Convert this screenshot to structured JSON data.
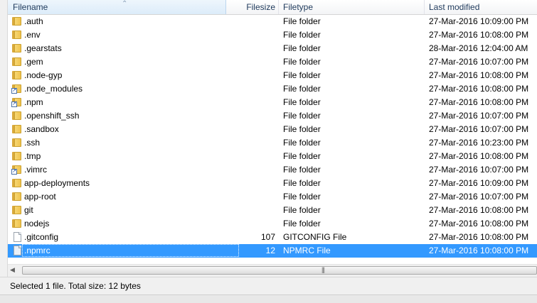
{
  "columns": {
    "filename": "Filename",
    "filesize": "Filesize",
    "filetype": "Filetype",
    "last_modified": "Last modified"
  },
  "files": [
    {
      "name": ".auth",
      "size": "",
      "type": "File folder",
      "modified": "27-Mar-2016 10:09:00 PM",
      "icon": "folder-icon"
    },
    {
      "name": ".env",
      "size": "",
      "type": "File folder",
      "modified": "27-Mar-2016 10:08:00 PM",
      "icon": "folder-icon"
    },
    {
      "name": ".gearstats",
      "size": "",
      "type": "File folder",
      "modified": "28-Mar-2016 12:04:00 AM",
      "icon": "folder-icon"
    },
    {
      "name": ".gem",
      "size": "",
      "type": "File folder",
      "modified": "27-Mar-2016 10:07:00 PM",
      "icon": "folder-icon"
    },
    {
      "name": ".node-gyp",
      "size": "",
      "type": "File folder",
      "modified": "27-Mar-2016 10:08:00 PM",
      "icon": "folder-icon"
    },
    {
      "name": ".node_modules",
      "size": "",
      "type": "File folder",
      "modified": "27-Mar-2016 10:08:00 PM",
      "icon": "folder-link-icon"
    },
    {
      "name": ".npm",
      "size": "",
      "type": "File folder",
      "modified": "27-Mar-2016 10:08:00 PM",
      "icon": "folder-link-icon"
    },
    {
      "name": ".openshift_ssh",
      "size": "",
      "type": "File folder",
      "modified": "27-Mar-2016 10:07:00 PM",
      "icon": "folder-icon"
    },
    {
      "name": ".sandbox",
      "size": "",
      "type": "File folder",
      "modified": "27-Mar-2016 10:07:00 PM",
      "icon": "folder-icon"
    },
    {
      "name": ".ssh",
      "size": "",
      "type": "File folder",
      "modified": "27-Mar-2016 10:23:00 PM",
      "icon": "folder-icon"
    },
    {
      "name": ".tmp",
      "size": "",
      "type": "File folder",
      "modified": "27-Mar-2016 10:08:00 PM",
      "icon": "folder-icon"
    },
    {
      "name": ".vimrc",
      "size": "",
      "type": "File folder",
      "modified": "27-Mar-2016 10:07:00 PM",
      "icon": "folder-link-icon"
    },
    {
      "name": "app-deployments",
      "size": "",
      "type": "File folder",
      "modified": "27-Mar-2016 10:09:00 PM",
      "icon": "folder-icon"
    },
    {
      "name": "app-root",
      "size": "",
      "type": "File folder",
      "modified": "27-Mar-2016 10:07:00 PM",
      "icon": "folder-icon"
    },
    {
      "name": "git",
      "size": "",
      "type": "File folder",
      "modified": "27-Mar-2016 10:08:00 PM",
      "icon": "folder-icon"
    },
    {
      "name": "nodejs",
      "size": "",
      "type": "File folder",
      "modified": "27-Mar-2016 10:08:00 PM",
      "icon": "folder-icon"
    },
    {
      "name": ".gitconfig",
      "size": "107",
      "type": "GITCONFIG File",
      "modified": "27-Mar-2016 10:08:00 PM",
      "icon": "file-icon"
    },
    {
      "name": ".npmrc",
      "size": "12",
      "type": "NPMRC File",
      "modified": "27-Mar-2016 10:08:00 PM",
      "icon": "file-icon",
      "selected": true
    }
  ],
  "status": {
    "text": "Selected 1 file. Total size: 12 bytes"
  },
  "colors": {
    "selection": "#3399ff",
    "header_text": "#1e395b",
    "folder": "#f0c34d"
  }
}
